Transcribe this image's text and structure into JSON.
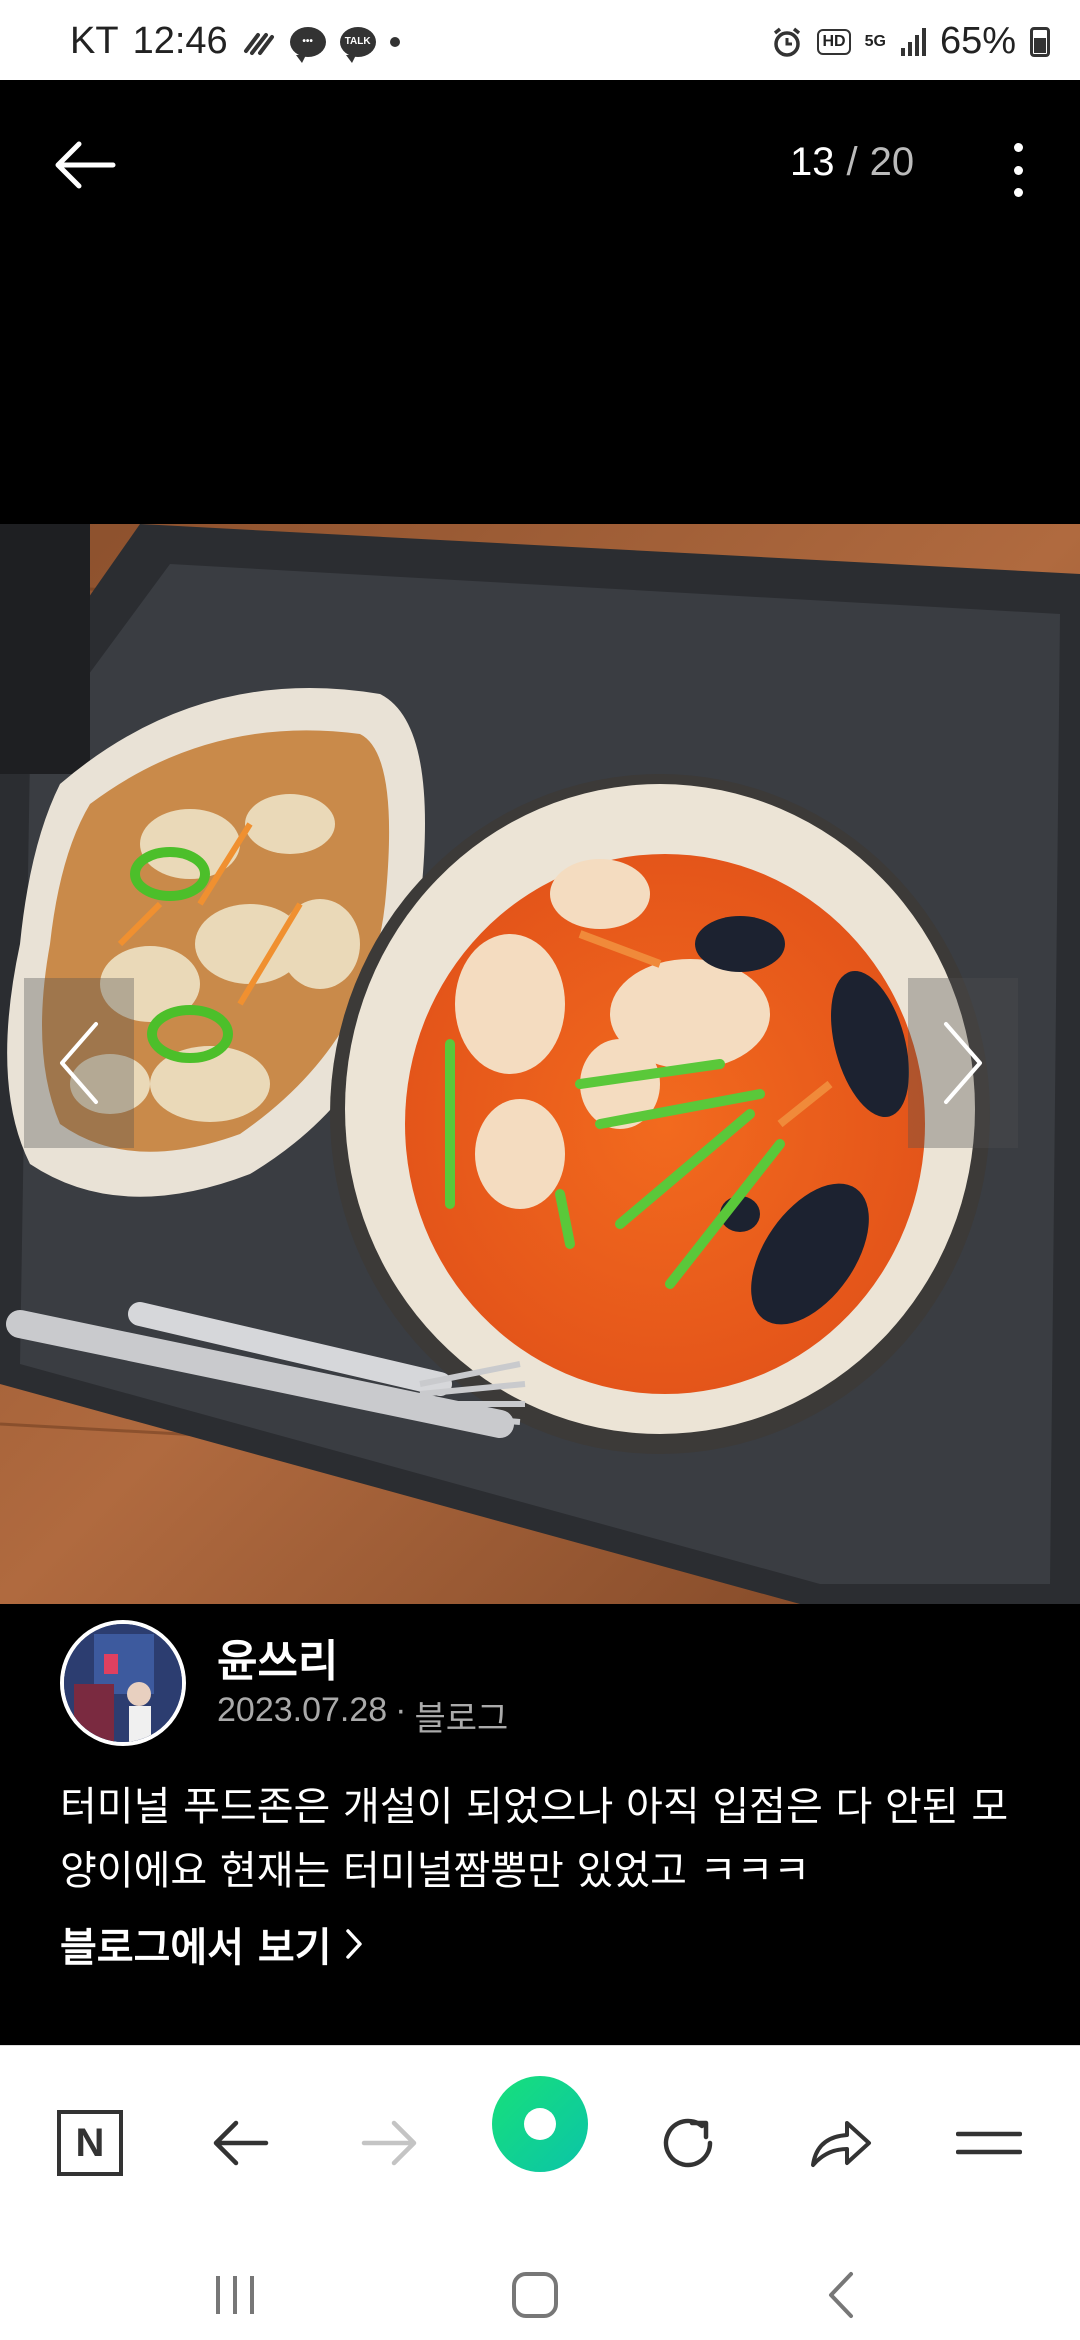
{
  "status_bar": {
    "carrier": "KT",
    "time": "12:46",
    "talk_badge": "TALK",
    "hd_badge": "HD",
    "network": "5G",
    "battery": "65%"
  },
  "viewer": {
    "current_page": "13",
    "separator": "/",
    "total_pages": "20"
  },
  "photo": {
    "description_icon": "food-photo-jjamppong-tangsuyuk"
  },
  "author": {
    "name": "윤쓰리",
    "date": "2023.07.28",
    "meta_dot": "·",
    "source": "블로그",
    "caption": "터미널 푸드존은 개설이 되었으나 아직 입점은 다 안된 모양이에요 현재는 터미널짬뽕만 있었고 ㅋㅋㅋ",
    "view_blog_label": "블로그에서 보기"
  },
  "toolbar": {
    "home_label": "N"
  },
  "colors": {
    "green_accent": "#0fd68e",
    "background": "#000000"
  }
}
